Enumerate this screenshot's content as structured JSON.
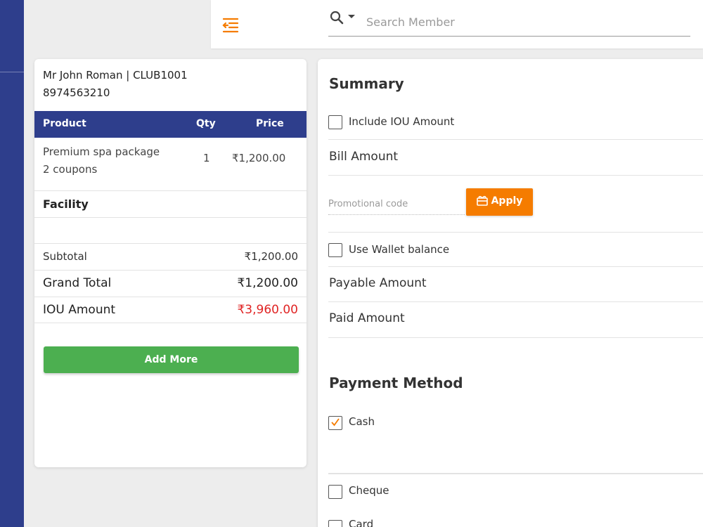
{
  "colors": {
    "primary": "#2e3e8c",
    "accent": "#f57c00",
    "success": "#4caf50",
    "danger": "#e02424"
  },
  "header": {
    "menu_icon": "menu-collapse-icon",
    "search": {
      "icon": "search-icon",
      "placeholder": "Search Member",
      "value": ""
    }
  },
  "member": {
    "name_line": "Mr John Roman | CLUB1001",
    "phone": "8974563210"
  },
  "cart": {
    "columns": [
      "Product",
      "Qty",
      "Price"
    ],
    "items": [
      {
        "name": "Premium spa package",
        "detail": "2 coupons",
        "qty": "1",
        "price": "₹1,200.00"
      }
    ],
    "facility_label": "Facility",
    "subtotal": {
      "label": "Subtotal",
      "value": "₹1,200.00"
    },
    "grand_total": {
      "label": "Grand Total",
      "value": "₹1,200.00"
    },
    "iou_amount": {
      "label": "IOU Amount",
      "value": "₹3,960.00"
    },
    "add_more_label": "Add More"
  },
  "summary": {
    "title": "Summary",
    "include_iou_label": "Include IOU Amount",
    "bill_amount_label": "Bill Amount",
    "promo_placeholder": "Promotional code",
    "apply_label": "Apply",
    "wallet_label": "Use Wallet balance",
    "payable_label": "Payable Amount",
    "paid_label": "Paid Amount"
  },
  "payment": {
    "title": "Payment Method",
    "methods": [
      {
        "label": "Cash",
        "checked": true
      },
      {
        "label": "Cheque",
        "checked": false
      },
      {
        "label": "Card",
        "checked": false
      }
    ]
  }
}
